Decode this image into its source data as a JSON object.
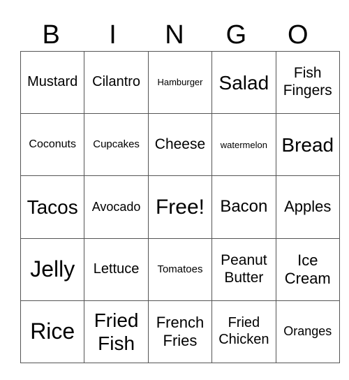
{
  "header": {
    "letters": [
      "B",
      "I",
      "N",
      "G",
      "O"
    ]
  },
  "grid": {
    "rows": [
      [
        "Mustard",
        "Cilantro",
        "Hamburger",
        "Salad",
        "Fish Fingers"
      ],
      [
        "Coconuts",
        "Cupcakes",
        "Cheese",
        "watermelon",
        "Bread"
      ],
      [
        "Tacos",
        "Avocado",
        "Free!",
        "Bacon",
        "Apples"
      ],
      [
        "Jelly",
        "Lettuce",
        "Tomatoes",
        "Peanut Butter",
        "Ice Cream"
      ],
      [
        "Rice",
        "Fried Fish",
        "French Fries",
        "Fried Chicken",
        "Oranges"
      ]
    ]
  }
}
